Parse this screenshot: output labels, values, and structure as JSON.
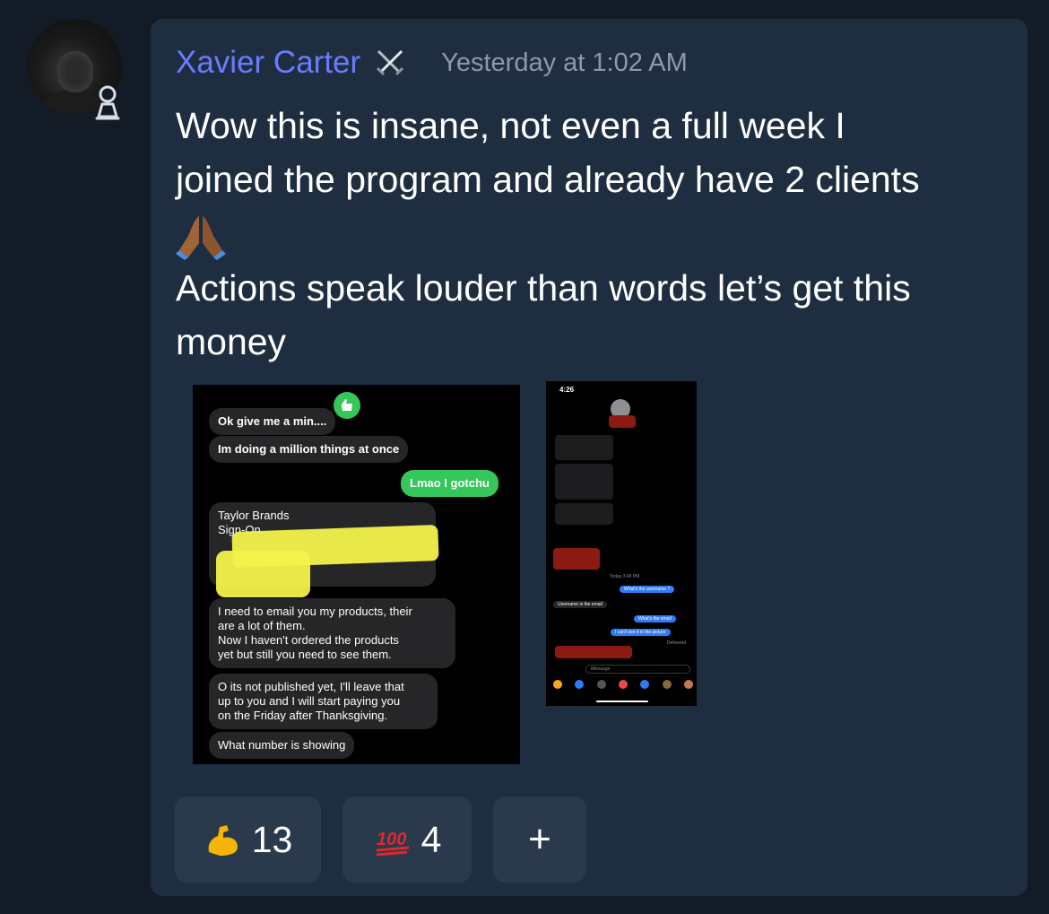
{
  "author": {
    "name": "Xavier Carter",
    "badge_icon": "crossed-swords-icon",
    "avatar_badge_icon": "pawn-icon"
  },
  "timestamp": "Yesterday at 1:02 AM",
  "message": {
    "line1": "Wow this is insane, not even a full week I",
    "line2": "joined the program and already have 2 clients",
    "emoji": "folded-hands",
    "line3": "Actions speak louder than words let’s get this",
    "line4": "money"
  },
  "attachment1": {
    "bubbles": [
      "Ok give me a min....",
      "Im doing a million things at once",
      "Lmao I gotchu",
      "Taylor Brands\nSign-On",
      "I need to email you my products, their\nare a lot of them.\nNow I haven't ordered the products\nyet but still you need to see them.",
      "O its not published yet, I'll leave that\nup to you and I will start paying you\non the Friday after Thanksgiving.",
      "What number is showing"
    ]
  },
  "attachment2": {
    "status_time": "4:26",
    "day_label": "Today 3:49 PM",
    "bubbles": [
      "What's the username ?",
      "Username is the email",
      "What's the email",
      "I can't see it in the picture"
    ],
    "delivered": "Delivered",
    "input_placeholder": "iMessage"
  },
  "reactions": [
    {
      "emoji": "flexed-biceps",
      "count": "13"
    },
    {
      "emoji": "hundred-points",
      "count": "4"
    },
    {
      "label": "+"
    }
  ],
  "colors": {
    "background": "#131b27",
    "card": "#1e2d40",
    "name": "#6b7cff",
    "reaction_bg": "#2a394c"
  }
}
